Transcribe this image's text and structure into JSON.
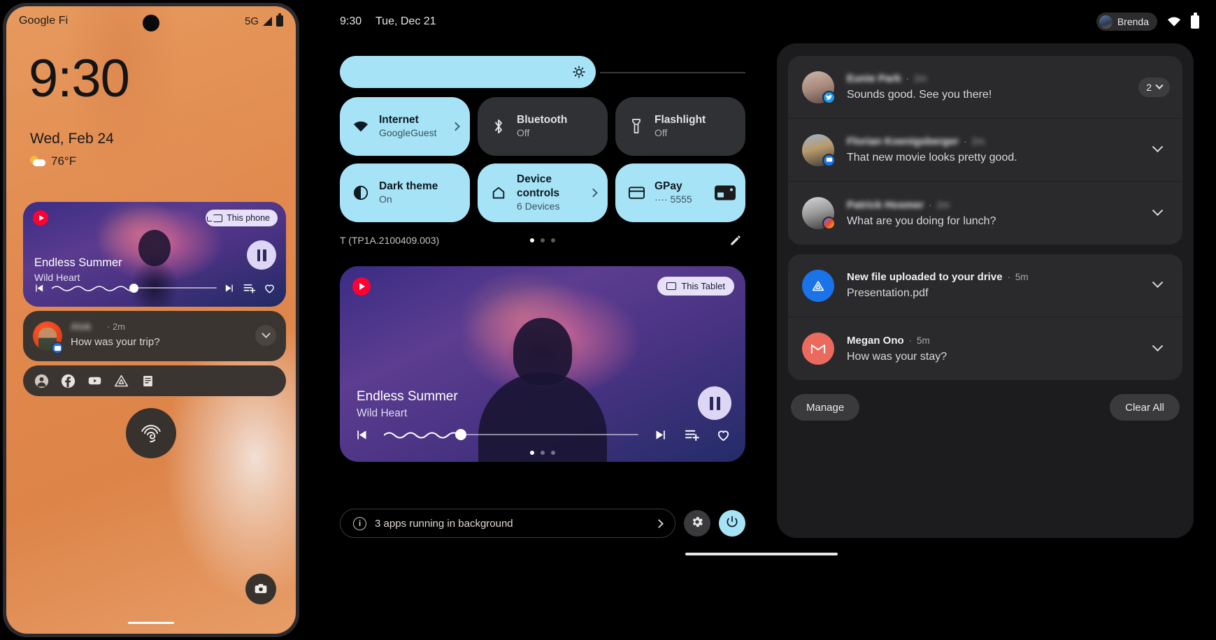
{
  "phone": {
    "status": {
      "carrier": "Google Fi",
      "network": "5G"
    },
    "clock": "9:30",
    "date": "Wed, Feb 24",
    "temperature": "76°F",
    "media": {
      "app_icon": "youtube-music-icon",
      "cast_chip": "This phone",
      "title": "Endless Summer",
      "artist": "Wild Heart",
      "state": "playing"
    },
    "notification": {
      "name": "Alok",
      "time": "2m",
      "message": "How was your trip?"
    },
    "app_row": [
      "contact-avatar-icon",
      "facebook-icon",
      "youtube-icon",
      "drive-icon",
      "keep-icon"
    ],
    "fingerprint": "fingerprint-icon",
    "camera_shortcut": "camera-icon"
  },
  "tablet": {
    "status": {
      "time": "9:30",
      "date": "Tue, Dec 21",
      "user": "Brenda"
    },
    "quick_settings": {
      "brightness_label": "brightness-slider",
      "tiles": [
        {
          "name": "Internet",
          "sub": "GoogleGuest",
          "on": true,
          "icon": "wifi-icon",
          "affordance": "chevron"
        },
        {
          "name": "Bluetooth",
          "sub": "Off",
          "on": false,
          "icon": "bluetooth-icon",
          "affordance": "none"
        },
        {
          "name": "Flashlight",
          "sub": "Off",
          "on": false,
          "icon": "flashlight-icon",
          "affordance": "none"
        },
        {
          "name": "Dark theme",
          "sub": "On",
          "on": true,
          "icon": "contrast-icon",
          "affordance": "none"
        },
        {
          "name": "Device controls",
          "sub": "6 Devices",
          "on": true,
          "icon": "home-icon",
          "affordance": "chevron"
        },
        {
          "name": "GPay",
          "sub": "···· 5555",
          "on": true,
          "icon": "card-icon",
          "affordance": "card"
        }
      ],
      "build": "T (TP1A.2100409.003)",
      "page_dots": 3,
      "active_dot": 0,
      "edit_icon": "pencil-icon"
    },
    "media": {
      "app_icon": "youtube-music-icon",
      "cast_chip": "This Tablet",
      "title": "Endless Summer",
      "artist": "Wild Heart",
      "state": "playing",
      "page_dots": 3,
      "active_dot": 0
    },
    "footer": {
      "background_apps": "3 apps running in background",
      "settings_icon": "gear-icon",
      "power_icon": "power-icon"
    }
  },
  "notifications": {
    "groups": [
      {
        "rows": [
          {
            "name": "Eunie Park",
            "blur": true,
            "time": "2m",
            "time_blur": true,
            "body": "Sounds good. See you there!",
            "avatar": "avatar-eunie",
            "badge": "twitter-icon",
            "trailing": "count",
            "count": "2"
          },
          {
            "name": "Florian Koenigsberger",
            "blur": true,
            "time": "2m",
            "time_blur": true,
            "body": "That new movie looks pretty good.",
            "avatar": "avatar-florian",
            "badge": "messages-icon",
            "trailing": "chevron"
          },
          {
            "name": "Patrick Hosmer",
            "blur": true,
            "time": "2m",
            "time_blur": true,
            "body": "What are you doing for lunch?",
            "avatar": "avatar-patrick",
            "badge": "photos-icon",
            "trailing": "chevron"
          }
        ]
      },
      {
        "rows": [
          {
            "name": "New file uploaded to your drive",
            "blur": false,
            "time": "5m",
            "time_blur": false,
            "body": "Presentation.pdf",
            "avatar": "drive-app-icon",
            "badge": "none",
            "trailing": "chevron"
          },
          {
            "name": "Megan Ono",
            "blur": false,
            "time": "5m",
            "time_blur": false,
            "body": "How was your stay?",
            "avatar": "gmail-app-icon",
            "badge": "none",
            "trailing": "chevron"
          }
        ]
      }
    ],
    "manage_label": "Manage",
    "clear_label": "Clear All"
  },
  "colors": {
    "accent_cyan": "#a7e3f7",
    "panel_bg": "#1c1c1e",
    "tile_off": "#303134",
    "phone_wallpaper": "#e1894e"
  }
}
